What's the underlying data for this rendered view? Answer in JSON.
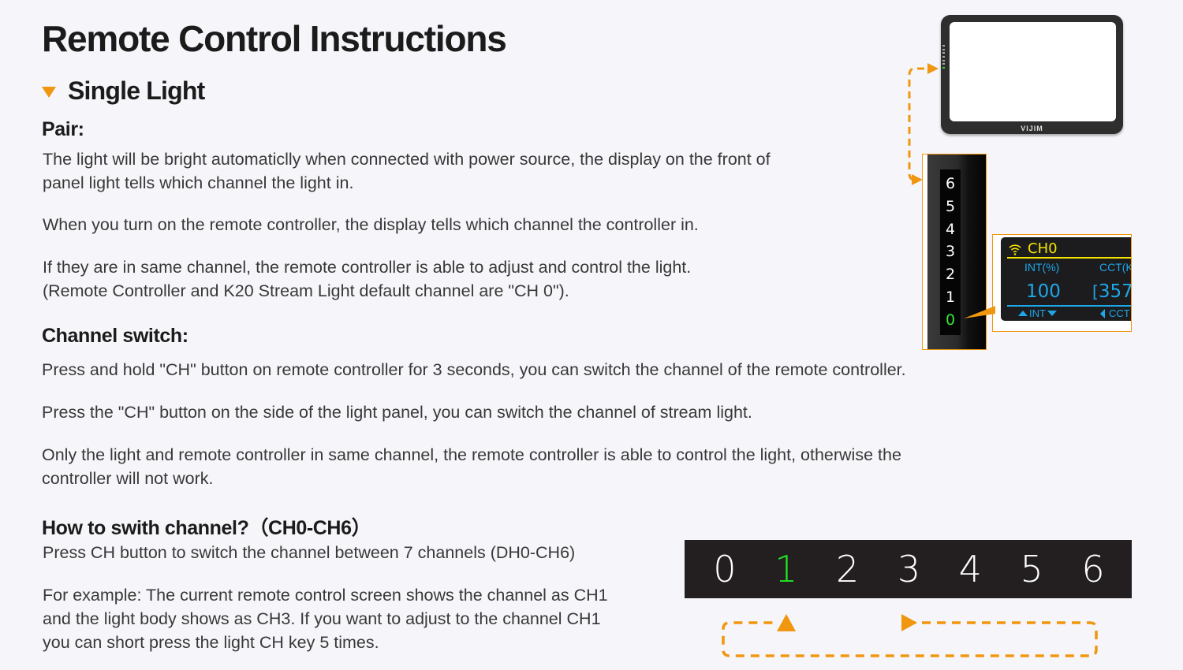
{
  "title": "Remote Control Instructions",
  "section": {
    "label": "Single Light",
    "icon": "triangle-down-icon",
    "accent_color": "#f0960f"
  },
  "pair": {
    "heading": "Pair:",
    "paragraphs": [
      [
        "The light will be bright automaticlly when connected with power source, the display on the front of",
        "panel light tells which channel the light in."
      ],
      [
        "When you turn on the remote controller, the display tells which channel the controller in."
      ],
      [
        "If they are in same channel, the remote controller is able to adjust and control the light.",
        "(Remote Controller and K20 Stream Light default channel are \"CH 0\")."
      ]
    ]
  },
  "channel_switch": {
    "heading": "Channel switch:",
    "paragraphs": [
      [
        "Press and hold \"CH\" button on remote controller for 3 seconds, you can switch the channel of the remote controller."
      ],
      [
        "Press the \"CH\" button on the side of the light panel, you can switch the channel of stream light."
      ],
      [
        "Only the light and remote controller in same channel, the remote controller is able to control the light, otherwise the",
        "controller will not work."
      ]
    ]
  },
  "how_to": {
    "heading": "How to swith channel?（CH0-CH6）",
    "paragraphs": [
      [
        "Press CH button to switch the channel between 7 channels (DH0-CH6)"
      ],
      [
        "For example: The current remote control screen shows the channel as CH1",
        "and the light body shows as CH3. If you want to adjust to the channel CH1",
        "you can short press the light CH key 5 times."
      ]
    ]
  },
  "light_panel": {
    "brand": "VIJIM",
    "side_channels": [
      "6",
      "5",
      "4",
      "3",
      "2",
      "1",
      "0"
    ],
    "active_channel": "0",
    "active_color": "#34e834"
  },
  "remote_display": {
    "signal_icon": "wifi-signal-icon",
    "channel": "CH0",
    "int_label": "INT(%)",
    "int_value": "100",
    "cct_label": "CCT(K",
    "cct_value": "357",
    "int_control": "INT",
    "cct_control": "CCT",
    "channel_color": "#f5e400",
    "value_color": "#1ea7e8"
  },
  "channel_bar": {
    "channels": [
      "0",
      "1",
      "2",
      "3",
      "4",
      "5",
      "6"
    ],
    "active_channel": "1",
    "active_color": "#22e622"
  }
}
